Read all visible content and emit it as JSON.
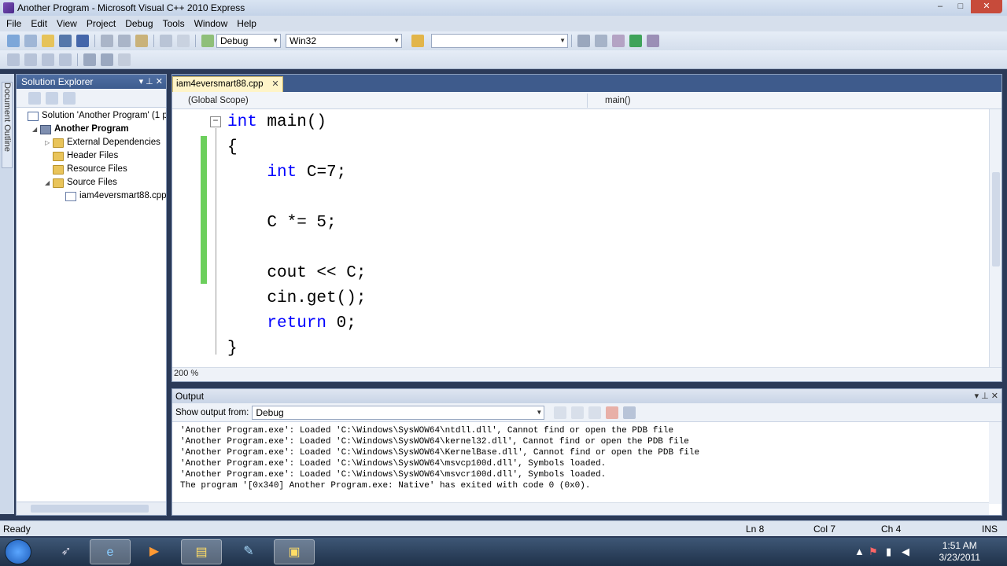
{
  "window": {
    "title": "Another Program - Microsoft Visual C++ 2010 Express",
    "controls": {
      "minimize": "–",
      "maximize": "□",
      "close": "✕"
    }
  },
  "menu": [
    "File",
    "Edit",
    "View",
    "Project",
    "Debug",
    "Tools",
    "Window",
    "Help"
  ],
  "toolbar": {
    "config": "Debug",
    "platform": "Win32",
    "find": ""
  },
  "side_strip": {
    "label": "Document Outline"
  },
  "solution_explorer": {
    "title": "Solution Explorer",
    "pin": "▾ ⊥ ✕",
    "items": [
      {
        "label": "Solution 'Another Program' (1 p",
        "icon": "solution-icon",
        "indent": 0,
        "expander": ""
      },
      {
        "label": "Another Program",
        "icon": "project-icon",
        "indent": 1,
        "expander": "◢",
        "bold": true
      },
      {
        "label": "External Dependencies",
        "icon": "folder-icon",
        "indent": 2,
        "expander": "▷"
      },
      {
        "label": "Header Files",
        "icon": "folder-icon",
        "indent": 2,
        "expander": ""
      },
      {
        "label": "Resource Files",
        "icon": "folder-icon",
        "indent": 2,
        "expander": ""
      },
      {
        "label": "Source Files",
        "icon": "folder-icon",
        "indent": 2,
        "expander": "◢"
      },
      {
        "label": "iam4eversmart88.cpp",
        "icon": "cpp-file-icon",
        "indent": 3,
        "expander": ""
      }
    ]
  },
  "editor": {
    "tab": {
      "label": "iam4eversmart88.cpp",
      "close": "✕"
    },
    "scope": "(Global Scope)",
    "member": "main()",
    "code_lines": [
      {
        "text": "int main()",
        "kw": [
          "int"
        ]
      },
      {
        "text": "{",
        "kw": []
      },
      {
        "text": "    int C=7;",
        "kw": [
          "int"
        ]
      },
      {
        "text": "",
        "kw": []
      },
      {
        "text": "    C *= 5;",
        "kw": []
      },
      {
        "text": "",
        "kw": []
      },
      {
        "text": "    cout << C;",
        "kw": []
      },
      {
        "text": "    cin.get();",
        "kw": []
      },
      {
        "text": "    return 0;",
        "kw": [
          "return"
        ]
      },
      {
        "text": "}",
        "kw": []
      }
    ],
    "zoom": "200 %",
    "collapse_symbol": "−"
  },
  "output": {
    "title": "Output",
    "controls": "▾ ⊥ ✕",
    "show_output_from_label": "Show output from:",
    "source": "Debug",
    "lines": [
      "'Another Program.exe': Loaded 'C:\\Windows\\SysWOW64\\ntdll.dll', Cannot find or open the PDB file",
      "'Another Program.exe': Loaded 'C:\\Windows\\SysWOW64\\kernel32.dll', Cannot find or open the PDB file",
      "'Another Program.exe': Loaded 'C:\\Windows\\SysWOW64\\KernelBase.dll', Cannot find or open the PDB file",
      "'Another Program.exe': Loaded 'C:\\Windows\\SysWOW64\\msvcp100d.dll', Symbols loaded.",
      "'Another Program.exe': Loaded 'C:\\Windows\\SysWOW64\\msvcr100d.dll', Symbols loaded.",
      "The program '[0x340] Another Program.exe: Native' has exited with code 0 (0x0)."
    ]
  },
  "status": {
    "ready": "Ready",
    "line": "Ln 8",
    "col": "Col 7",
    "ch": "Ch 4",
    "ins": "INS"
  },
  "taskbar": {
    "time": "1:51 AM",
    "date": "3/23/2011",
    "apps": [
      "ie-icon",
      "media-player-icon",
      "explorer-icon",
      "tool-icon",
      "visual-cpp-icon"
    ]
  },
  "colors": {
    "keyword": "#0000ff",
    "changebar": "#6ccf5c",
    "accent": "#3e5b8c"
  }
}
